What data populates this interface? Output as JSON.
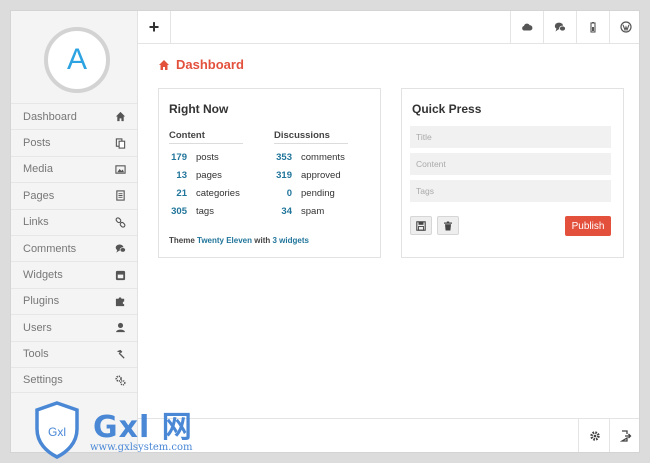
{
  "user": {
    "avatar_letter": "A"
  },
  "sidebar": {
    "items": [
      {
        "label": "Dashboard",
        "icon": "home-icon"
      },
      {
        "label": "Posts",
        "icon": "documents-icon"
      },
      {
        "label": "Media",
        "icon": "image-icon"
      },
      {
        "label": "Pages",
        "icon": "page-icon"
      },
      {
        "label": "Links",
        "icon": "link-icon"
      },
      {
        "label": "Comments",
        "icon": "comments-icon"
      },
      {
        "label": "Widgets",
        "icon": "widget-icon"
      },
      {
        "label": "Plugins",
        "icon": "puzzle-icon"
      },
      {
        "label": "Users",
        "icon": "user-icon"
      },
      {
        "label": "Tools",
        "icon": "hammer-icon"
      },
      {
        "label": "Settings",
        "icon": "gears-icon"
      }
    ]
  },
  "topbar": {
    "add_label": "+",
    "right_icons": [
      "cloud-icon",
      "comments-icon",
      "battery-icon",
      "wordpress-icon"
    ]
  },
  "page": {
    "title": "Dashboard",
    "title_icon": "home-icon",
    "accent": "#e3513d"
  },
  "right_now": {
    "title": "Right Now",
    "content_header": "Content",
    "discussions_header": "Discussions",
    "content": [
      {
        "count": "179",
        "label": "posts"
      },
      {
        "count": "13",
        "label": "pages"
      },
      {
        "count": "21",
        "label": "categories"
      },
      {
        "count": "305",
        "label": "tags"
      }
    ],
    "discussions": [
      {
        "count": "353",
        "label": "comments"
      },
      {
        "count": "319",
        "label": "approved"
      },
      {
        "count": "0",
        "label": "pending"
      },
      {
        "count": "34",
        "label": "spam"
      }
    ],
    "theme_prefix": "Theme",
    "theme_name": "Twenty Eleven",
    "theme_mid": "with",
    "theme_widgets": "3 widgets"
  },
  "quick_press": {
    "title": "Quick Press",
    "title_placeholder": "Title",
    "content_placeholder": "Content",
    "tags_placeholder": "Tags",
    "publish_label": "Publish"
  },
  "bottombar": {
    "icons": [
      "gear-icon",
      "logout-icon"
    ]
  },
  "watermark": {
    "text": "Gxl 网",
    "badge": "Gxl",
    "url": "www.gxlsystem.com"
  }
}
